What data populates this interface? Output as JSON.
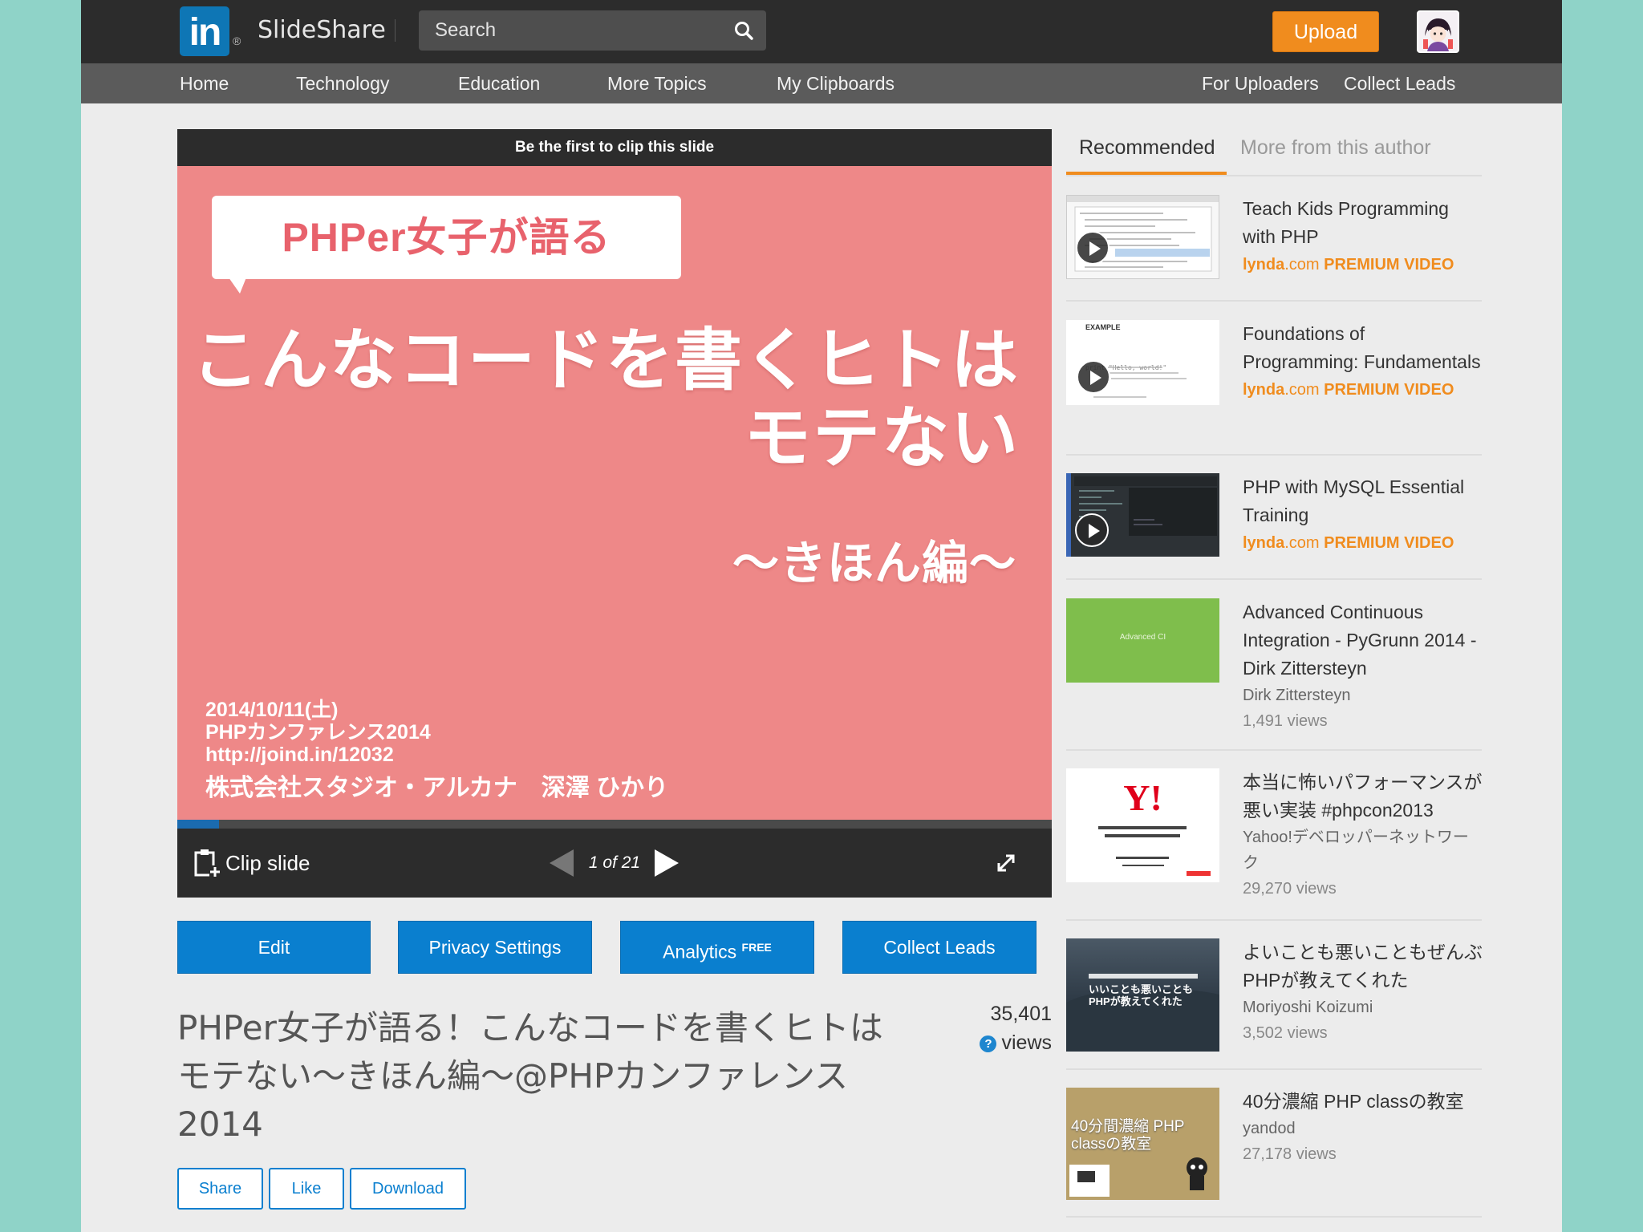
{
  "header": {
    "logo_mark": "in",
    "logo_reg": "®",
    "brand": "SlideShare",
    "search_placeholder": "Search",
    "upload_label": "Upload"
  },
  "nav": {
    "left": [
      "Home",
      "Technology",
      "Education",
      "More Topics",
      "My Clipboards"
    ],
    "right": [
      "For Uploaders",
      "Collect Leads"
    ]
  },
  "player": {
    "clip_banner": "Be the first to clip this slide",
    "clip_label": "Clip slide",
    "pager": "1 of 21",
    "progress_fraction": 0.048,
    "slide": {
      "bubble": "PHPer女子が語る",
      "title_line1": "こんなコードを書くヒトは",
      "title_line2": "モテない",
      "subtitle": "〜きほん編〜",
      "date": "2014/10/11(土)",
      "event": "PHPカンファレンス2014",
      "url": "http://joind.in/12032",
      "org": "株式会社スタジオ・アルカナ　深澤 ひかり"
    }
  },
  "actions": {
    "edit": "Edit",
    "privacy": "Privacy Settings",
    "analytics": "Analytics",
    "analytics_badge": "FREE",
    "collect": "Collect Leads"
  },
  "presentation": {
    "title": "PHPer女子が語る！こんなコードを書くヒトはモテない〜きほん編〜@PHPカンファレンス2014",
    "views_count": "35,401",
    "views_label": "views",
    "share": "Share",
    "like": "Like",
    "download": "Download"
  },
  "sidebar": {
    "tab_recommended": "Recommended",
    "tab_more": "More from this author",
    "items": [
      {
        "title": "Teach Kids Programming with PHP",
        "lynda_a": "lynda",
        "lynda_b": ".com",
        "lynda_c": " PREMIUM VIDEO"
      },
      {
        "title": "Foundations of Programming: Fundamentals",
        "lynda_a": "lynda",
        "lynda_b": ".com",
        "lynda_c": " PREMIUM VIDEO",
        "thumb_label": "EXAMPLE"
      },
      {
        "title": "PHP with MySQL Essential Training",
        "lynda_a": "lynda",
        "lynda_b": ".com",
        "lynda_c": " PREMIUM VIDEO"
      },
      {
        "title": "Advanced Continuous Integration - PyGrunn 2014 - Dirk Zittersteyn",
        "author": "Dirk Zittersteyn",
        "views": "1,491 views",
        "thumb_label": "Advanced CI"
      },
      {
        "title": "本当に怖いパフォーマンスが悪い実装 #phpcon2013",
        "author": "Yahoo!デベロッパーネットワーク",
        "views": "29,270 views",
        "thumb_label": "Y!"
      },
      {
        "title": "よいことも悪いこともぜんぶPHPが教えてくれた",
        "author": "Moriyoshi Koizumi",
        "views": "3,502 views",
        "thumb_label": "いいことも悪いことも PHPが教えてくれた"
      },
      {
        "title": "40分濃縮 PHP classの教室",
        "author": "yandod",
        "views": "27,178 views",
        "thumb_label": "40分間濃縮 PHP classの教室"
      }
    ]
  },
  "colors": {
    "accent_orange": "#f08c1e",
    "button_blue": "#0a7fcf",
    "slide_pink": "#ee8888",
    "topbar": "#2c2c2c"
  }
}
